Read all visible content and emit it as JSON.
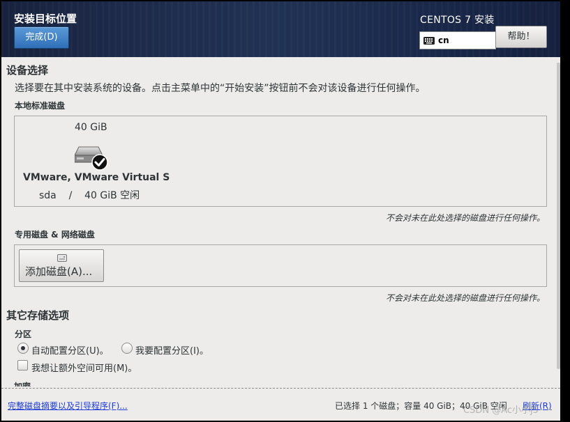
{
  "header": {
    "title": "安装目标位置",
    "done_label": "完成(D)",
    "product": "CENTOS 7 安装",
    "keyboard_layout": "cn",
    "help_label": "帮助！"
  },
  "device_selection": {
    "title": "设备选择",
    "description": "选择要在其中安装系统的设备。点击主菜单中的“开始安装”按钮前不会对该设备进行任何操作。",
    "local_disks_label": "本地标准磁盘",
    "disk": {
      "size": "40 GiB",
      "name": "VMware, VMware Virtual S",
      "device": "sda",
      "separator": "/",
      "free": "40 GiB 空闲",
      "selected": true
    },
    "local_note": "不会对未在此处选择的磁盘进行任何操作。",
    "special_disks_label": "专用磁盘 & 网络磁盘",
    "add_disk_label": "添加磁盘(A)...",
    "special_note": "不会对未在此处选择的磁盘进行任何操作。"
  },
  "other_storage": {
    "title": "其它存储选项",
    "partition_label": "分区",
    "auto_partition": "自动配置分区(U)。",
    "manual_partition": "我要配置分区(I)。",
    "auto_checked": true,
    "extra_space": "我想让额外空间可用(M)。",
    "encryption_label": "加密"
  },
  "footer": {
    "summary_link": "完整磁盘摘要以及引导程序(F)...",
    "status": "已选择 1 个磁盘；容量 40 GiB；40 GiB 空闲",
    "refresh": "刷新(R)"
  },
  "watermark": "CSDN @Ac小小j5",
  "colors": {
    "header_bg": "#1f2c4d",
    "done_button": "#3b7fc6",
    "link": "#1c3bd6",
    "panel_bg": "#edeceb"
  }
}
